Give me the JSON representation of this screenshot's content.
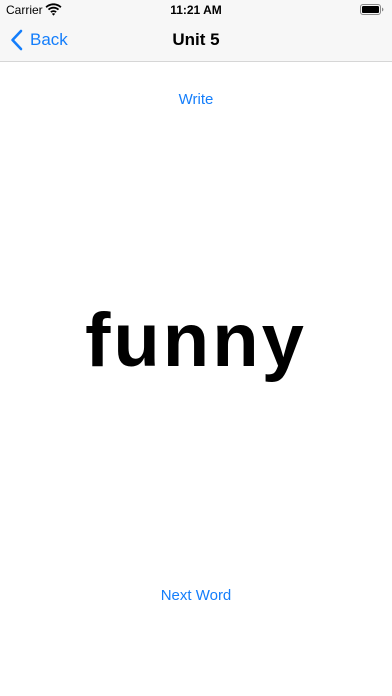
{
  "status_bar": {
    "carrier": "Carrier",
    "time": "11:21 AM"
  },
  "nav": {
    "back_label": "Back",
    "title": "Unit 5"
  },
  "main": {
    "write_label": "Write",
    "word": "funny",
    "next_word_label": "Next Word"
  },
  "colors": {
    "accent": "#147efb",
    "nav_background": "#f7f7f7",
    "text": "#000000"
  },
  "icons": {
    "wifi": "wifi-icon",
    "battery": "battery-icon",
    "back": "chevron-left-icon"
  }
}
